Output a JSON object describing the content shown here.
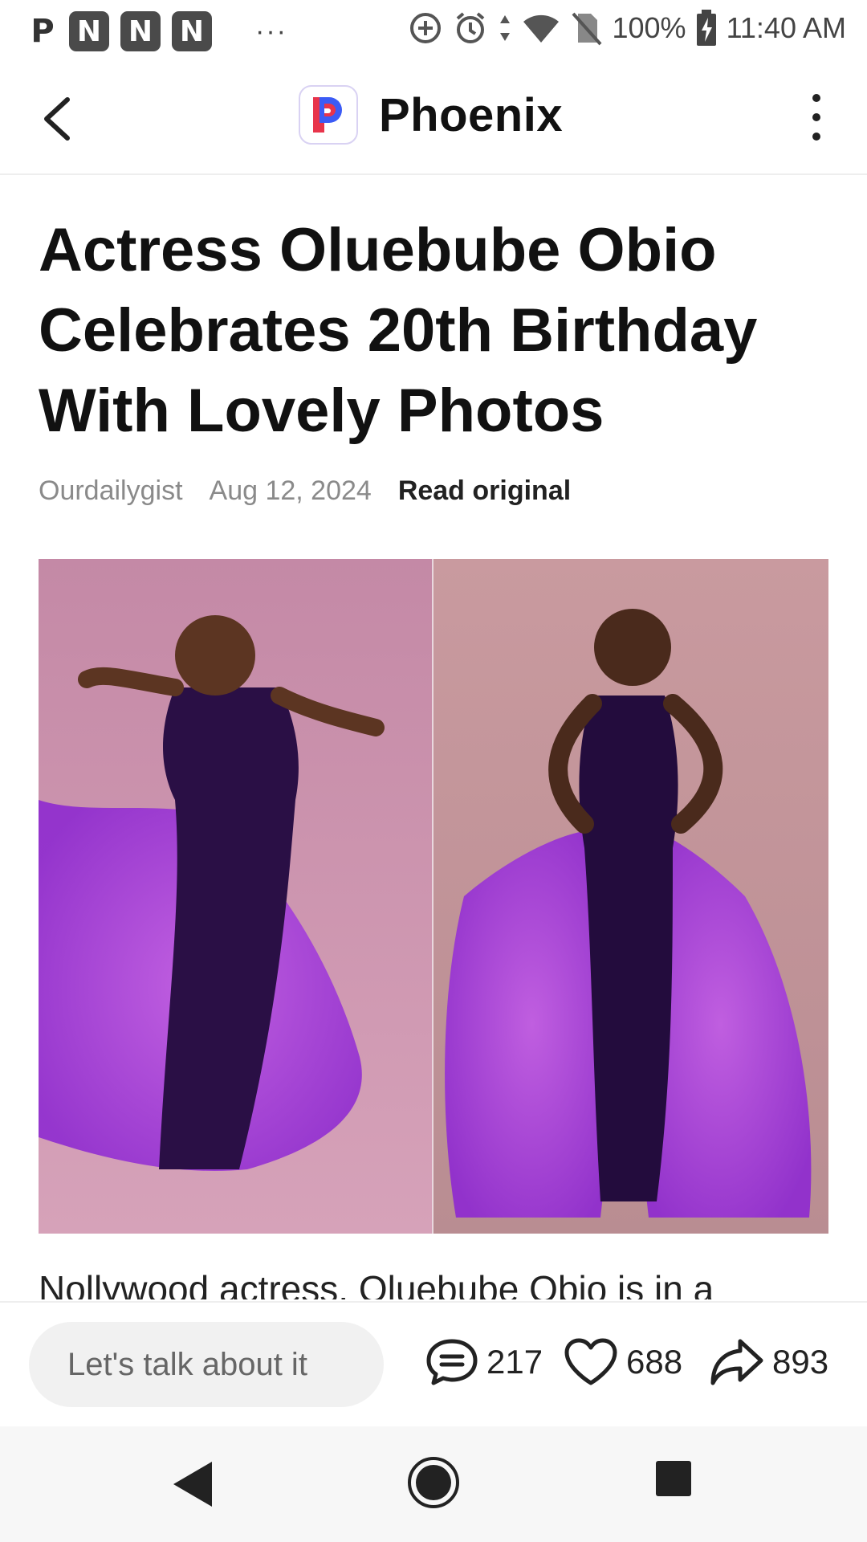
{
  "status_bar": {
    "left_badges": [
      "P",
      "N",
      "N",
      "N"
    ],
    "overflow": "···",
    "battery": "100%",
    "time": "11:40 AM",
    "icons": [
      "data-saver-icon",
      "alarm-icon",
      "data-arrows-icon",
      "wifi-icon",
      "no-sim-icon",
      "battery-charging-icon"
    ]
  },
  "app_bar": {
    "brand": "Phoenix",
    "icons": [
      "back-arrow-icon",
      "phoenix-logo",
      "more-vertical-icon"
    ]
  },
  "article": {
    "headline": "Actress Oluebube Obio Celebrates 20th Birthday With Lovely Photos",
    "source": "Ourdailygist",
    "date": "Aug 12, 2024",
    "read_original": "Read original",
    "body_preview": "Nollywood actress, Oluebube Obio is in a"
  },
  "bottom_bar": {
    "comment_placeholder": "Let's talk about it",
    "comments_count": "217",
    "likes_count": "688",
    "shares_count": "893"
  },
  "colors": {
    "accent_purple": "#8e2ad0",
    "logo_red": "#e8344b",
    "logo_blue": "#3b5bf5",
    "photo_background": "#c78aa8"
  }
}
